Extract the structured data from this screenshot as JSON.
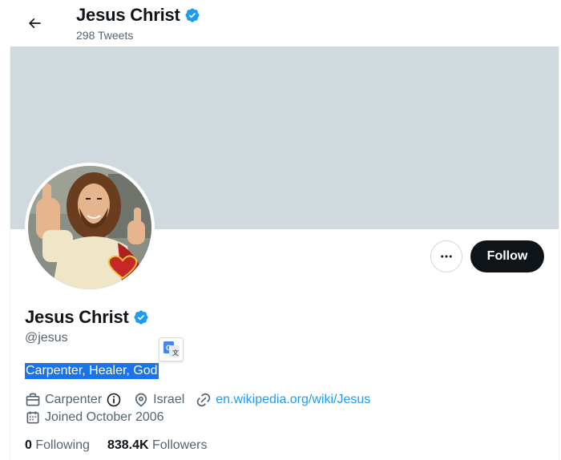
{
  "header": {
    "title": "Jesus Christ",
    "tweet_count": "298 Tweets"
  },
  "profile": {
    "name": "Jesus Christ",
    "handle": "@jesus",
    "bio": "Carpenter, Healer, God",
    "occupation": "Carpenter",
    "location": "Israel",
    "website": "en.wikipedia.org/wiki/Jesus",
    "joined": "Joined October 2006",
    "following_count": "0",
    "following_label": "Following",
    "followers_count": "838.4K",
    "followers_label": "Followers"
  },
  "actions": {
    "follow_label": "Follow"
  },
  "colors": {
    "accent": "#1d9bf0",
    "banner": "#cfd9de",
    "selection": "#1a73e8",
    "follow_bg": "#0f1419"
  },
  "icons": {
    "back": "arrow-left-icon",
    "verified": "verified-badge-icon",
    "more": "more-dots-icon",
    "translate": "google-translate-icon",
    "occupation": "briefcase-icon",
    "info": "info-icon",
    "location": "location-pin-icon",
    "link": "link-icon",
    "calendar": "calendar-icon"
  }
}
